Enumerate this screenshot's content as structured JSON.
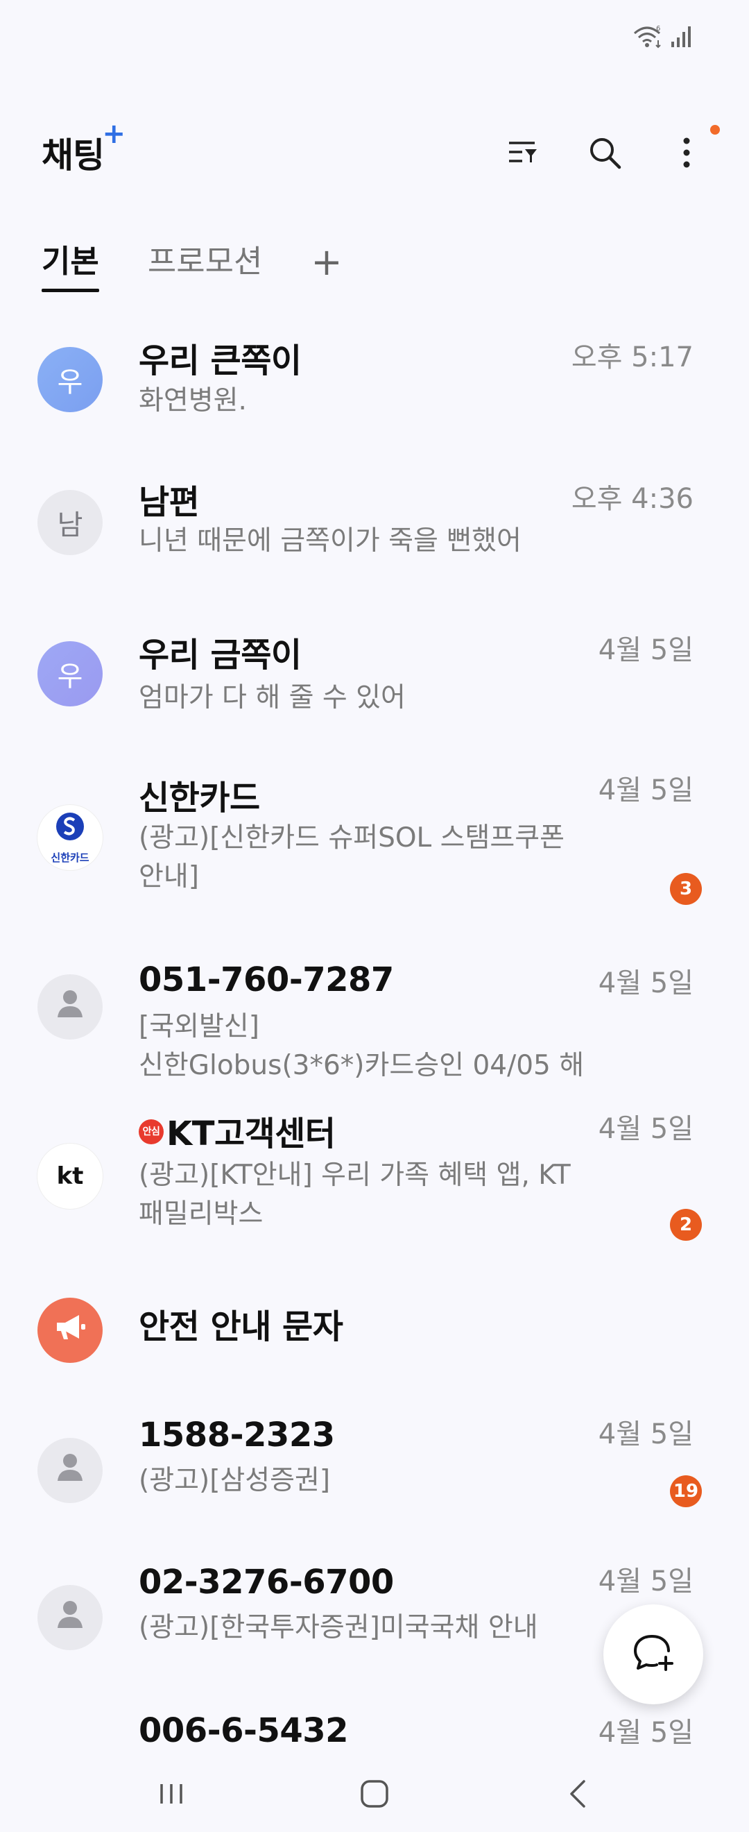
{
  "status_bar": {
    "icons": [
      "wifi-6-icon",
      "signal-icon"
    ]
  },
  "header": {
    "title": "채팅",
    "title_plus": "+",
    "icons": [
      "filter-icon",
      "search-icon",
      "more-options-icon"
    ]
  },
  "tabs": [
    {
      "label": "기본",
      "active": true
    },
    {
      "label": "프로모션",
      "active": false
    },
    {
      "label": "+",
      "active": false
    }
  ],
  "conversations": [
    {
      "avatar_text": "우",
      "avatar_style": "blue",
      "name": "우리 큰쪽이",
      "time": "오후 5:17",
      "preview": "화연병원.",
      "badge": ""
    },
    {
      "avatar_text": "남",
      "avatar_style": "gray",
      "name": "남편",
      "time": "오후 4:36",
      "preview": "니년 때문에 금쪽이가 죽을 뻔했어",
      "badge": ""
    },
    {
      "avatar_text": "우",
      "avatar_style": "purple",
      "name": "우리 금쪽이",
      "time": "4월 5일",
      "preview": "엄마가 다 해 줄 수 있어",
      "badge": ""
    },
    {
      "avatar_text": "신한카드",
      "avatar_style": "white",
      "name": "신한카드",
      "time": "4월 5일",
      "preview": "(광고)[신한카드 슈퍼SOL 스탬프쿠폰\n안내]",
      "badge": "3"
    },
    {
      "avatar_text": "",
      "avatar_style": "gray",
      "name": "051-760-7287",
      "time": "4월 5일",
      "preview": "[국외발신]\n신한Globus(3*6*)카드승인 04/05 해",
      "badge": ""
    },
    {
      "avatar_text": "kt",
      "avatar_style": "white",
      "name": "KT고객센터",
      "name_prefix": "안심",
      "time": "4월 5일",
      "preview": "(광고)[KT안내] 우리 가족 혜택 앱, KT\n패밀리박스",
      "badge": "2"
    },
    {
      "avatar_text": "",
      "avatar_style": "orange",
      "name": "안전 안내 문자",
      "time": "",
      "preview": "",
      "badge": ""
    },
    {
      "avatar_text": "",
      "avatar_style": "gray",
      "name": "1588-2323",
      "time": "4월 5일",
      "preview": "(광고)[삼성증권]",
      "badge": "19"
    },
    {
      "avatar_text": "",
      "avatar_style": "gray",
      "name": "02-3276-6700",
      "time": "4월 5일",
      "preview": "(광고)[한국투자증권]미국국채 안내",
      "badge": ""
    },
    {
      "avatar_text": "",
      "avatar_style": "gray",
      "name": "006-6-5432",
      "time": "4월 5일",
      "preview": "",
      "badge": ""
    }
  ],
  "fab": {
    "icon": "new-chat-icon"
  },
  "nav_bar": {
    "icons": [
      "recents-icon",
      "home-icon",
      "back-icon"
    ]
  },
  "colors": {
    "accent_blue": "#2f6fe4",
    "badge_orange": "#e85b1f",
    "background": "#f8f8fd"
  }
}
